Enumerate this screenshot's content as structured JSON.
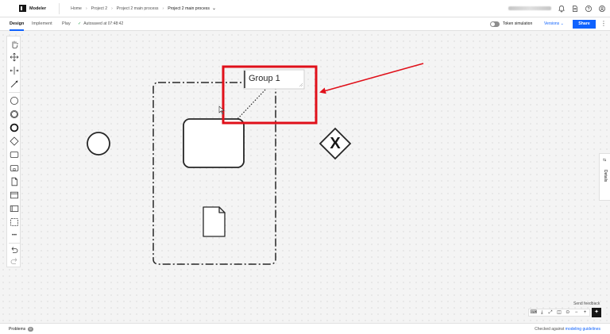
{
  "header": {
    "app_name": "Modeler",
    "breadcrumbs": [
      "Home",
      "Project 2",
      "Project 2 main process"
    ],
    "breadcrumb_separator": "›",
    "current": "Project 2 main process",
    "current_chevron": "⌄",
    "icons": [
      "notification-icon",
      "docs-icon",
      "help-icon",
      "user-icon"
    ]
  },
  "toolbar": {
    "tabs": [
      "Design",
      "Implement",
      "Play"
    ],
    "active_tab": "Design",
    "autosave_check": "✓",
    "autosave": "Autosaved at 07:48:42",
    "token_simulation": "Token simulation",
    "versions": "Versions ⌄",
    "share": "Share",
    "more": "⋮"
  },
  "canvas": {
    "group_label": "Group 1",
    "gateway_symbol": "X",
    "annotation_color": "#e0101a"
  },
  "palette": {
    "tools": [
      "hand-tool-icon",
      "lasso-tool-icon",
      "space-tool-icon",
      "connect-tool-icon",
      "start-event-icon",
      "intermediate-event-icon",
      "end-event-icon",
      "gateway-icon",
      "task-icon",
      "subprocess-icon",
      "data-object-icon",
      "data-store-icon",
      "pool-icon",
      "group-icon",
      "more-icon",
      "undo-icon",
      "redo-icon"
    ],
    "more_glyph": "•••"
  },
  "details_panel": {
    "label": "Details",
    "icon": "⇆"
  },
  "controls": {
    "send_feedback": "Send feedback",
    "buttons": [
      "⌨",
      "⤓",
      "⤢",
      "◫",
      "⊙",
      "−",
      "+"
    ],
    "ai": "✦"
  },
  "status": {
    "problems": "Problems",
    "problems_count": "0",
    "checked_prefix": "Checked against ",
    "checked_link": "modeling guidelines"
  },
  "colors": {
    "accent": "#0f62fe",
    "annotation": "#e0101a"
  }
}
